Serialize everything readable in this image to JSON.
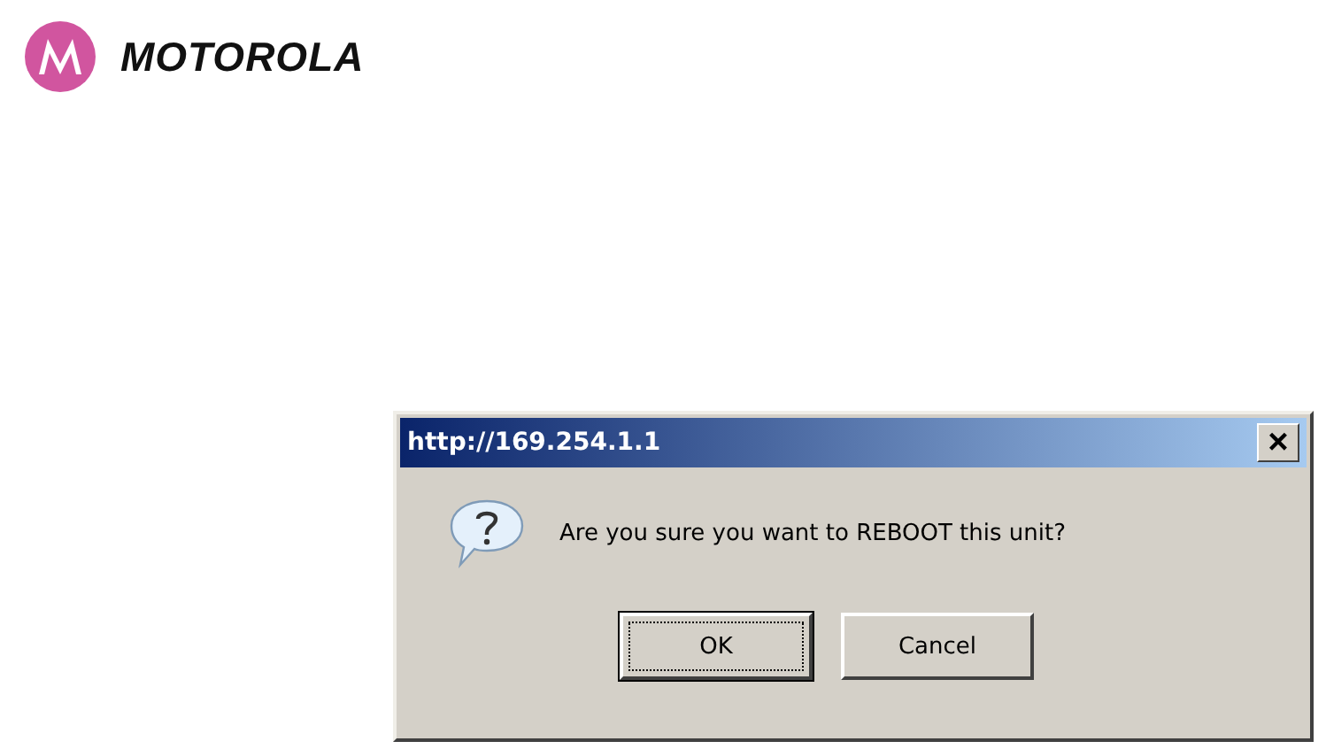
{
  "logo": {
    "wordmark": "MOTOROLA"
  },
  "dialog": {
    "title": "http://169.254.1.1",
    "close": "×",
    "message": "Are you sure you want to REBOOT this unit?",
    "buttons": [
      {
        "label": "OK",
        "focused": true
      },
      {
        "label": "Cancel",
        "focused": false
      }
    ]
  }
}
